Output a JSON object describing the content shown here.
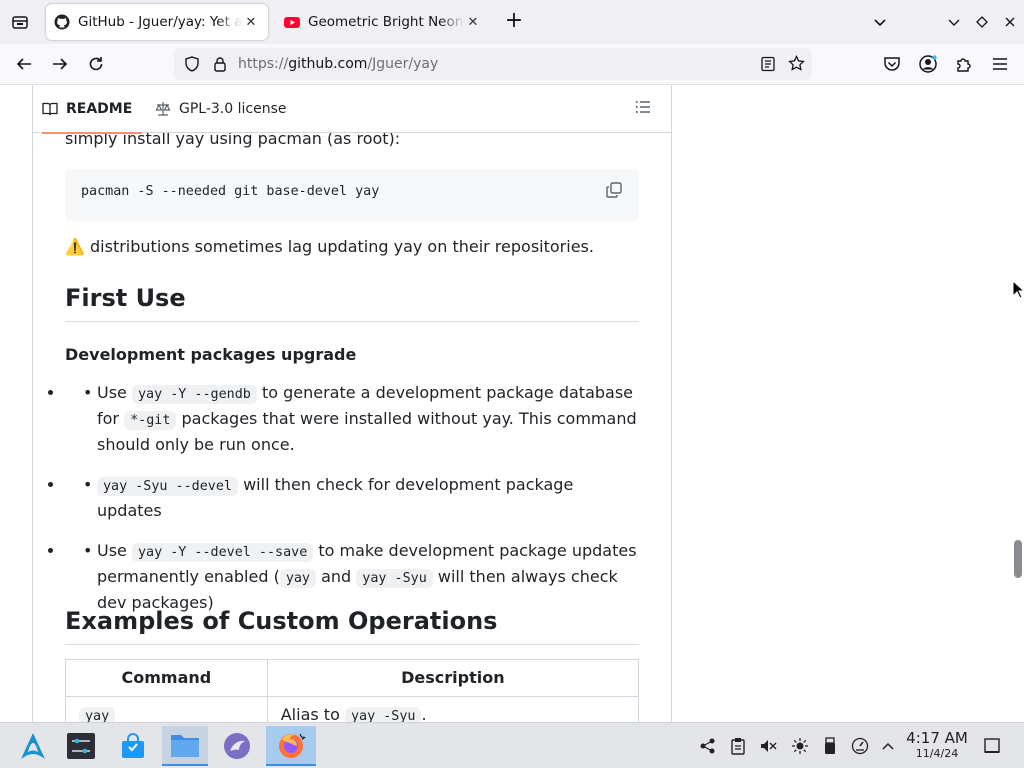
{
  "browser": {
    "tabs": [
      {
        "title": "GitHub - Jguer/yay: Yet another Yogurt - An AUR Helper written in Go",
        "favicon": "github-icon",
        "active": true
      },
      {
        "title": "Geometric Bright Neon Triangles",
        "favicon": "youtube-icon",
        "active": false
      }
    ],
    "url_scheme": "https://",
    "url_host": "github.com",
    "url_path": "/Jguer/yay"
  },
  "readme": {
    "tab_readme": "README",
    "tab_license": "GPL-3.0 license"
  },
  "content": {
    "intro_line": "simply install yay using pacman (as root):",
    "install_cmd": "pacman -S --needed git base-devel yay",
    "warning_emoji": "⚠️",
    "warning_text": "distributions sometimes lag updating yay on their repositories.",
    "first_use_heading": "First Use",
    "dev_heading": "Development packages upgrade",
    "bullet1": {
      "pre": "Use",
      "code1": "yay -Y --gendb",
      "mid": "to generate a development package database for",
      "code2": "*-git",
      "post": "packages that were installed without yay. This command should only be run once."
    },
    "bullet2": {
      "code": "yay -Syu --devel",
      "post": "will then check for development package updates"
    },
    "bullet3": {
      "pre": "Use",
      "code1": "yay -Y --devel --save",
      "mid": "to make development package updates permanently enabled (",
      "code2": "yay",
      "and": "and",
      "code3": "yay -Syu",
      "post": "will then always check dev packages)"
    },
    "examples_heading": "Examples of Custom Operations",
    "table": {
      "headers": [
        "Command",
        "Description"
      ],
      "rows": [
        {
          "cmd": "yay",
          "desc_pre": "Alias to",
          "desc_code": "yay -Syu",
          "desc_post": "."
        }
      ]
    }
  },
  "taskbar": {
    "time": "4:17 AM",
    "date": "11/4/24"
  }
}
